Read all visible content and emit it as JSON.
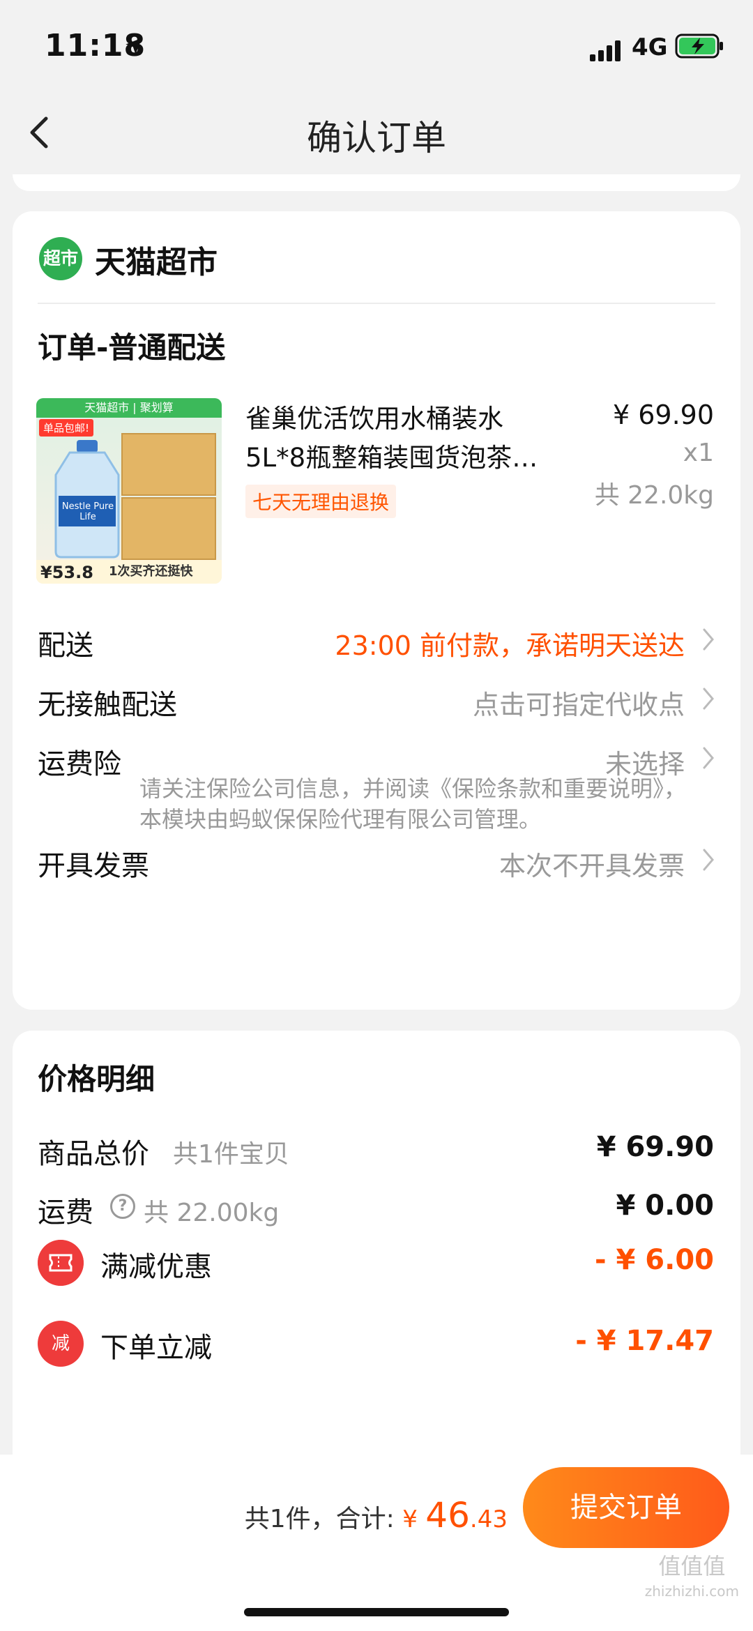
{
  "status": {
    "time": "11:18",
    "network": "4G"
  },
  "nav": {
    "title": "确认订单"
  },
  "store": {
    "icon_text": "超市",
    "name": "天猫超市"
  },
  "order": {
    "section_title": "订单-普通配送",
    "product": {
      "name_line1": "雀巢优活饮用水桶装水",
      "name_line2": "5L*8瓶整箱装囤货泡茶…",
      "price": "¥ 69.90",
      "qty": "x1",
      "weight": "共 22.0kg",
      "tag": "七天无理由退换",
      "image_top_text": "天猫超市 | 聚划算",
      "image_badge": "单品包邮!",
      "image_brand": "Nestle Pure Life",
      "image_price": "¥53.8",
      "image_slogan": "1次买齐还挺快"
    },
    "rows": {
      "delivery": {
        "label": "配送",
        "value": "23:00 前付款，承诺明天送达"
      },
      "contactless": {
        "label": "无接触配送",
        "value": "点击可指定代收点"
      },
      "insurance": {
        "label": "运费险",
        "value": "未选择"
      },
      "insurance_notice": "请关注保险公司信息，并阅读《保险条款和重要说明》，本模块由蚂蚁保保险代理有限公司管理。",
      "invoice": {
        "label": "开具发票",
        "value": "本次不开具发票"
      }
    }
  },
  "price_detail": {
    "title": "价格明细",
    "goods_total": {
      "label": "商品总价",
      "sub": "共1件宝贝",
      "value": "¥ 69.90"
    },
    "shipping": {
      "label": "运费",
      "sub": "共 22.00kg",
      "value": "¥ 0.00",
      "help_icon": "?"
    },
    "discount1": {
      "label": "满减优惠",
      "value": "- ¥ 6.00"
    },
    "discount2": {
      "label": "下单立减",
      "icon_text": "减",
      "value": "- ¥ 17.47"
    }
  },
  "bottom": {
    "summary": "共1件，合计:",
    "currency": "¥",
    "amount_int": "46",
    "amount_dec": ".43",
    "submit": "提交订单"
  },
  "watermark": {
    "line1": "值值值",
    "line2": "zhizhizhi.com"
  },
  "colors": {
    "accent": "#ff5000",
    "store_green": "#2fae52",
    "discount_red": "#ee3b3b"
  }
}
